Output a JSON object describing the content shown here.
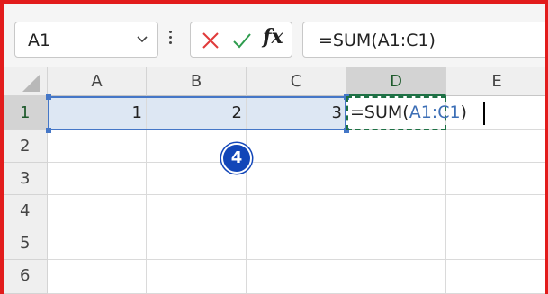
{
  "name_box": {
    "value": "A1"
  },
  "formula_bar": {
    "cancel_icon": "x-icon",
    "enter_icon": "check-icon",
    "fx_label": "fx",
    "formula": "=SUM(A1:C1)"
  },
  "columns": [
    "A",
    "B",
    "C",
    "D",
    "E"
  ],
  "rows": [
    "1",
    "2",
    "3",
    "4",
    "5",
    "6"
  ],
  "cells": {
    "A1": "1",
    "B1": "2",
    "C1": "3"
  },
  "editing_cell": {
    "address": "D1",
    "prefix": "=SUM(",
    "reference": "A1:C1",
    "suffix": ")"
  },
  "badge": {
    "label": "4"
  },
  "colors": {
    "frame": "#e21c1c",
    "cancel": "#e03a3a",
    "enter": "#2e9c4e",
    "reference": "#3d6fb6",
    "range_border": "#4577c7",
    "range_fill": "#dde7f3",
    "badge": "#1246b8"
  }
}
